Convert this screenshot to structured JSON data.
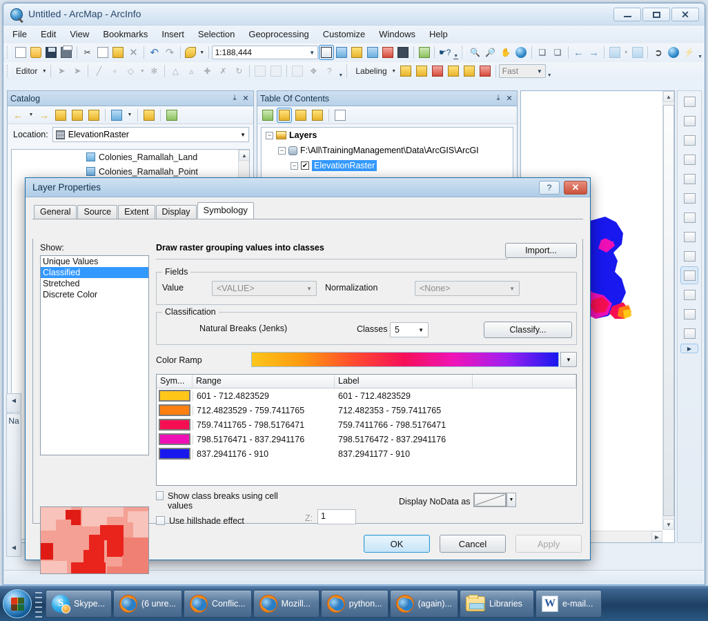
{
  "window": {
    "title": "Untitled - ArcMap - ArcInfo",
    "minimize": "–",
    "maximize": "□",
    "close": "✕"
  },
  "menu": [
    "File",
    "Edit",
    "View",
    "Bookmarks",
    "Insert",
    "Selection",
    "Geoprocessing",
    "Customize",
    "Windows",
    "Help"
  ],
  "toolbar_standard": {
    "scale_value": "1:188,444",
    "icons": [
      "new-map-icon",
      "open-icon",
      "save-icon",
      "print-icon",
      "cut-icon",
      "copy-icon",
      "paste-icon",
      "delete-icon",
      "undo-icon",
      "redo-icon",
      "add-data-icon",
      "editor-toolbar-icon",
      "table-of-contents-icon",
      "catalog-icon",
      "search-icon",
      "arctoolbox-icon",
      "python-window-icon",
      "model-builder-icon",
      "whats-this-icon",
      "zoom-in-icon",
      "zoom-out-icon",
      "pan-icon",
      "full-extent-icon",
      "fixed-zoom-in-icon",
      "fixed-zoom-out-icon",
      "back-extent-icon",
      "forward-extent-icon",
      "select-features-icon",
      "clear-selection-icon",
      "select-elements-icon",
      "identify-icon",
      "hyperlink-icon"
    ]
  },
  "toolbar_editor": {
    "editor_label": "Editor",
    "labeling_label": "Labeling",
    "quality_value": "Fast"
  },
  "catalog": {
    "title": "Catalog",
    "pin": "⤓",
    "close": "✕",
    "location_label": "Location:",
    "location_value": "ElevationRaster",
    "items": [
      "Colonies_Ramallah_Land",
      "Colonies_Ramallah_Point"
    ]
  },
  "toc": {
    "title": "Table Of Contents",
    "pin": "⤓",
    "close": "✕",
    "root": "Layers",
    "datasource": "F:\\All\\TrainingManagement\\Data\\ArcGIS\\ArcGI",
    "layer": "ElevationRaster"
  },
  "dialog": {
    "title": "Layer Properties",
    "help_glyph": "?",
    "close_glyph": "✕",
    "tabs": [
      {
        "label": "General",
        "active": false
      },
      {
        "label": "Source",
        "active": false
      },
      {
        "label": "Extent",
        "active": false
      },
      {
        "label": "Display",
        "active": false
      },
      {
        "label": "Symbology",
        "active": true
      }
    ],
    "show_label": "Show:",
    "show_options": [
      {
        "label": "Unique Values",
        "selected": false
      },
      {
        "label": "Classified",
        "selected": true
      },
      {
        "label": "Stretched",
        "selected": false
      },
      {
        "label": "Discrete Color",
        "selected": false
      }
    ],
    "draw_heading": "Draw raster grouping values into classes",
    "import_label": "Import...",
    "fields_legend": "Fields",
    "value_label": "Value",
    "value_selected": "<VALUE>",
    "normalization_label": "Normalization",
    "normalization_selected": "<None>",
    "classification_legend": "Classification",
    "classification_method": "Natural Breaks (Jenks)",
    "classes_label": "Classes",
    "classes_value": "5",
    "classify_label": "Classify...",
    "color_ramp_label": "Color Ramp",
    "table_headers": [
      "Sym...",
      "Range",
      "Label",
      ""
    ],
    "classes": [
      {
        "color": "#ffc61a",
        "range": "601 - 712.4823529",
        "label": "601 - 712.4823529"
      },
      {
        "color": "#ff7f10",
        "range": "712.4823529 - 759.7411765",
        "label": "712.482353 - 759.7411765"
      },
      {
        "color": "#f50f52",
        "range": "759.7411765 - 798.5176471",
        "label": "759.7411766 - 798.5176471"
      },
      {
        "color": "#ee10b6",
        "range": "798.5176471 - 837.2941176",
        "label": "798.5176472 - 837.2941176"
      },
      {
        "color": "#1818ef",
        "range": "837.2941176 - 910",
        "label": "837.2941177 - 910"
      }
    ],
    "show_class_breaks_label": "Show class breaks using cell values",
    "use_hillshade_label": "Use hillshade effect",
    "z_label": "Z:",
    "z_value": "1",
    "display_nodata_label": "Display NoData as",
    "ok_label": "OK",
    "cancel_label": "Cancel",
    "apply_label": "Apply"
  },
  "strips": {
    "name_strip": "Na"
  },
  "taskbar": {
    "items": [
      {
        "label": "Skype...",
        "icon": "skype-icon"
      },
      {
        "label": "(6 unre...",
        "icon": "firefox-icon"
      },
      {
        "label": "Conflic...",
        "icon": "firefox-icon"
      },
      {
        "label": "Mozill...",
        "icon": "firefox-icon"
      },
      {
        "label": "python...",
        "icon": "firefox-icon"
      },
      {
        "label": "(again)...",
        "icon": "firefox-icon"
      },
      {
        "label": "Libraries",
        "icon": "folder-icon"
      },
      {
        "label": "e-mail...",
        "icon": "word-icon"
      }
    ]
  },
  "colors": {
    "selection_blue": "#3399ff",
    "accent": "#1b6ea8",
    "annotation_pink": "#ff66cc"
  }
}
